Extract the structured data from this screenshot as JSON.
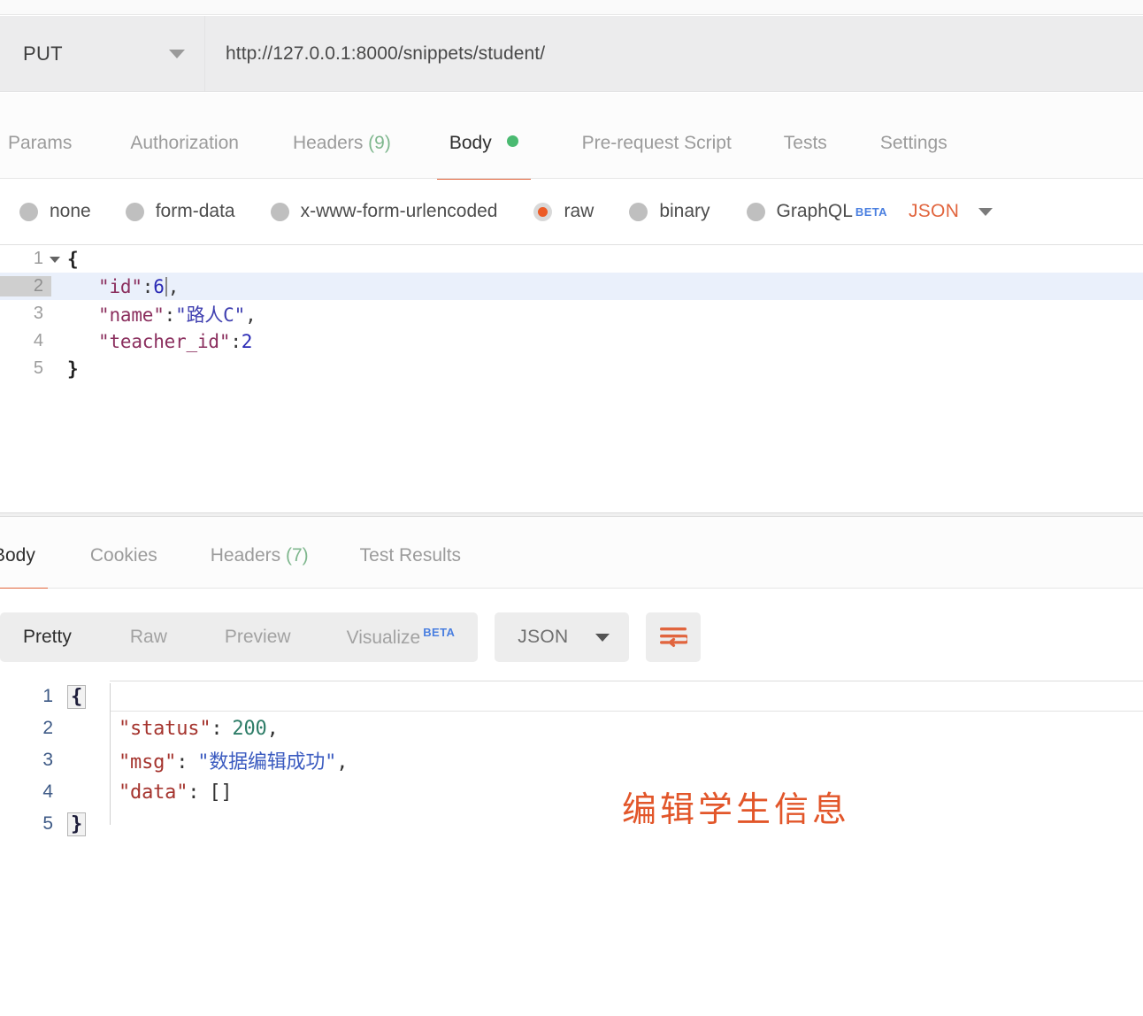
{
  "request": {
    "method": "PUT",
    "url": "http://127.0.0.1:8000/snippets/student/",
    "tabs": [
      {
        "label": "Params",
        "active": false
      },
      {
        "label": "Authorization",
        "active": false
      },
      {
        "label": "Headers",
        "count": "(9)",
        "active": false
      },
      {
        "label": "Body",
        "active": true
      },
      {
        "label": "Pre-request Script",
        "active": false
      },
      {
        "label": "Tests",
        "active": false
      },
      {
        "label": "Settings",
        "active": false
      }
    ],
    "body_types": [
      {
        "label": "none",
        "selected": false
      },
      {
        "label": "form-data",
        "selected": false
      },
      {
        "label": "x-www-form-urlencoded",
        "selected": false
      },
      {
        "label": "raw",
        "selected": true
      },
      {
        "label": "binary",
        "selected": false
      },
      {
        "label": "GraphQL",
        "selected": false,
        "badge": "BETA"
      }
    ],
    "raw_format": "JSON",
    "editor": {
      "lines": [
        {
          "num": "1",
          "open_brace": "{"
        },
        {
          "num": "2",
          "key": "\"id\"",
          "colon": ":",
          "value": "6",
          "value_type": "num",
          "trailing": ","
        },
        {
          "num": "3",
          "key": "\"name\"",
          "colon": ":",
          "value": "\"路人C\"",
          "value_type": "str",
          "trailing": ","
        },
        {
          "num": "4",
          "key": "\"teacher_id\"",
          "colon": ":",
          "value": "2",
          "value_type": "num",
          "trailing": ""
        },
        {
          "num": "5",
          "close_brace": "}"
        }
      ]
    }
  },
  "response": {
    "tabs": [
      {
        "label": "Body",
        "active": true
      },
      {
        "label": "Cookies",
        "active": false
      },
      {
        "label": "Headers",
        "count": "(7)",
        "active": false
      },
      {
        "label": "Test Results",
        "active": false
      }
    ],
    "view_modes": [
      {
        "label": "Pretty",
        "active": true
      },
      {
        "label": "Raw",
        "active": false
      },
      {
        "label": "Preview",
        "active": false
      },
      {
        "label": "Visualize",
        "active": false,
        "badge": "BETA"
      }
    ],
    "format": "JSON",
    "wrap_icon": "wrap-lines-icon",
    "body_lines": [
      {
        "num": "1",
        "open_brace": "{"
      },
      {
        "num": "2",
        "key": "\"status\"",
        "colon": ":",
        "value": "200",
        "value_type": "num",
        "trailing": ","
      },
      {
        "num": "3",
        "key": "\"msg\"",
        "colon": ":",
        "value": "\"数据编辑成功\"",
        "value_type": "str",
        "trailing": ","
      },
      {
        "num": "4",
        "key": "\"data\"",
        "colon": ":",
        "value": "[]",
        "value_type": "punc",
        "trailing": ""
      },
      {
        "num": "5",
        "close_brace": "}"
      }
    ]
  },
  "annotation": {
    "text": "编辑学生信息",
    "color": "#e2562a"
  }
}
